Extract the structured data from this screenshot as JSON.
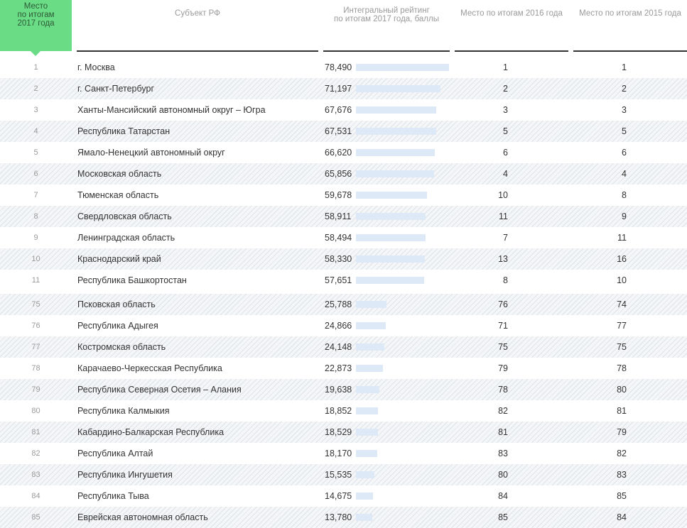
{
  "header": {
    "rank_lines": [
      "Место",
      "по итогам",
      "2017 года"
    ],
    "subject": "Субъект РФ",
    "rating_lines": [
      "Интегральный рейтинг",
      "по итогам 2017 года, баллы"
    ],
    "place_2016": "Место по итогам 2016 года",
    "place_2015": "Место по итогам 2015 года"
  },
  "colors": {
    "accent": "#6bdc86",
    "bar": "#dde9f7",
    "stripe": "#f4f6f8",
    "rule": "#333333"
  },
  "max_score": 78.49,
  "rows": [
    {
      "rank": "1",
      "name": "г. Москва",
      "score": "78,490",
      "p2016": "1",
      "p2015": "1"
    },
    {
      "rank": "2",
      "name": "г. Санкт-Петербург",
      "score": "71,197",
      "p2016": "2",
      "p2015": "2"
    },
    {
      "rank": "3",
      "name": "Ханты-Мансийский автономный округ – Югра",
      "score": "67,676",
      "p2016": "3",
      "p2015": "3"
    },
    {
      "rank": "4",
      "name": "Республика Татарстан",
      "score": "67,531",
      "p2016": "5",
      "p2015": "5"
    },
    {
      "rank": "5",
      "name": "Ямало-Ненецкий автономный округ",
      "score": "66,620",
      "p2016": "6",
      "p2015": "6"
    },
    {
      "rank": "6",
      "name": "Московская область",
      "score": "65,856",
      "p2016": "4",
      "p2015": "4"
    },
    {
      "rank": "7",
      "name": "Тюменская область",
      "score": "59,678",
      "p2016": "10",
      "p2015": "8"
    },
    {
      "rank": "8",
      "name": "Свердловская область",
      "score": "58,911",
      "p2016": "11",
      "p2015": "9"
    },
    {
      "rank": "9",
      "name": "Ленинградская область",
      "score": "58,494",
      "p2016": "7",
      "p2015": "11"
    },
    {
      "rank": "10",
      "name": "Краснодарский край",
      "score": "58,330",
      "p2016": "13",
      "p2015": "16"
    },
    {
      "rank": "11",
      "name": "Республика Башкортостан",
      "score": "57,651",
      "p2016": "8",
      "p2015": "10"
    },
    {
      "rank": "75",
      "name": "Псковская область",
      "score": "25,788",
      "p2016": "76",
      "p2015": "74"
    },
    {
      "rank": "76",
      "name": "Республика Адыгея",
      "score": "24,866",
      "p2016": "71",
      "p2015": "77"
    },
    {
      "rank": "77",
      "name": "Костромская область",
      "score": "24,148",
      "p2016": "75",
      "p2015": "75"
    },
    {
      "rank": "78",
      "name": "Карачаево-Черкесская Республика",
      "score": "22,873",
      "p2016": "79",
      "p2015": "78"
    },
    {
      "rank": "79",
      "name": "Республика Северная Осетия – Алания",
      "score": "19,638",
      "p2016": "78",
      "p2015": "80"
    },
    {
      "rank": "80",
      "name": "Республика Калмыкия",
      "score": "18,852",
      "p2016": "82",
      "p2015": "81"
    },
    {
      "rank": "81",
      "name": "Кабардино-Балкарская Республика",
      "score": "18,529",
      "p2016": "81",
      "p2015": "79"
    },
    {
      "rank": "82",
      "name": "Республика Алтай",
      "score": "18,170",
      "p2016": "83",
      "p2015": "82"
    },
    {
      "rank": "83",
      "name": "Республика Ингушетия",
      "score": "15,535",
      "p2016": "80",
      "p2015": "83"
    },
    {
      "rank": "84",
      "name": "Республика Тыва",
      "score": "14,675",
      "p2016": "84",
      "p2015": "85"
    },
    {
      "rank": "85",
      "name": "Еврейская автономная область",
      "score": "13,780",
      "p2016": "85",
      "p2015": "84"
    }
  ]
}
